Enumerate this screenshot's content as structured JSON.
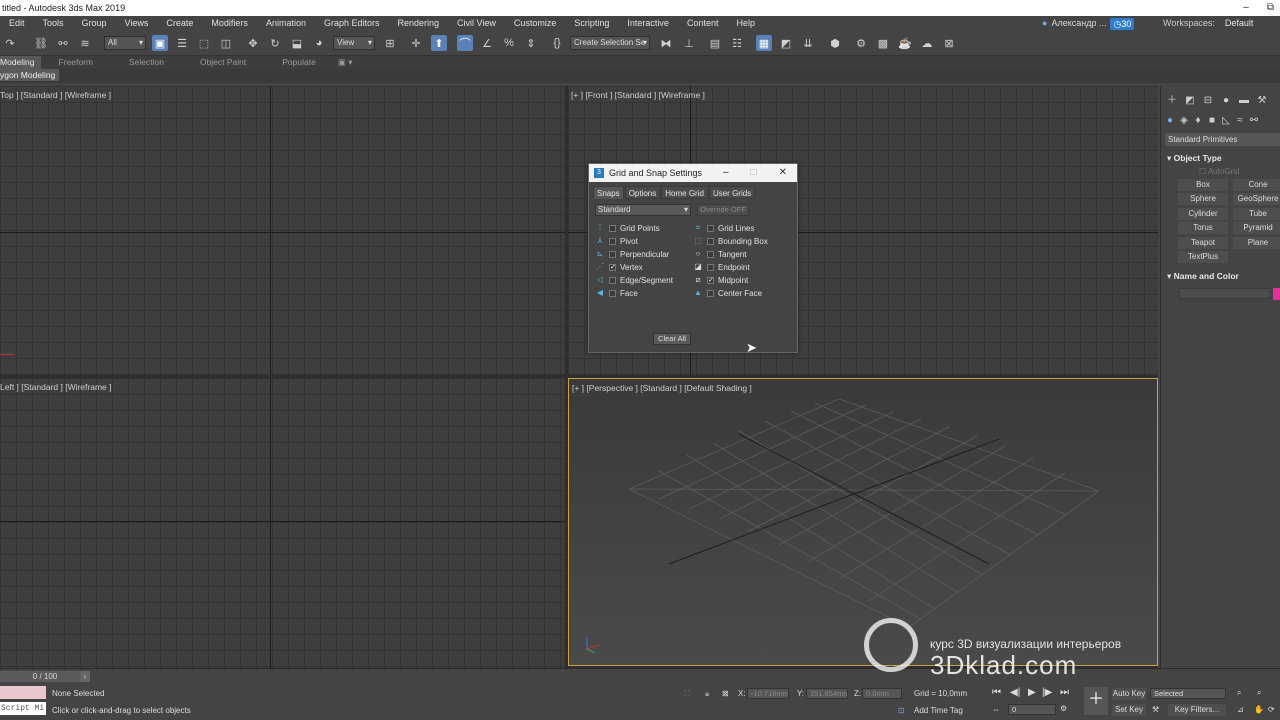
{
  "window": {
    "title": "titled - Autodesk 3ds Max 2019",
    "minimize": "–",
    "restore": "⧉"
  },
  "menu": {
    "items": [
      "Edit",
      "Tools",
      "Group",
      "Views",
      "Create",
      "Modifiers",
      "Animation",
      "Graph Editors",
      "Rendering",
      "Civil View",
      "Customize",
      "Scripting",
      "Interactive",
      "Content",
      "Help"
    ],
    "user": "Александр ...",
    "badge": "30",
    "workspaces_label": "Workspaces:",
    "workspaces_value": "Default"
  },
  "toolbar": {
    "filter": "All",
    "refcoord": "View",
    "named_selection": "Create Selection Se"
  },
  "ribbon": {
    "tabs": [
      "Modeling",
      "Freeform",
      "Selection",
      "Object Paint",
      "Populate"
    ],
    "sub_label": "Polygon Modeling",
    "sub_label_visible": "ygon Modeling"
  },
  "viewports": {
    "top": "Top ] [Standard ] [Wireframe ]",
    "front": "[+ ] [Front ] [Standard ] [Wireframe ]",
    "left": "Left ] [Standard ] [Wireframe ]",
    "perspective": "[+ ] [Perspective ] [Standard ] [Default Shading ]"
  },
  "dialog": {
    "title": "Grid and Snap Settings",
    "tabs": [
      "Snaps",
      "Options",
      "Home Grid",
      "User Grids"
    ],
    "preset": "Standard",
    "override": "Override OFF",
    "snaps_left": [
      {
        "label": "Grid Points",
        "checked": "",
        "icon": "grid-points-icon"
      },
      {
        "label": "Pivot",
        "checked": "",
        "icon": "pivot-icon"
      },
      {
        "label": "Perpendicular",
        "checked": "",
        "icon": "perpendicular-icon"
      },
      {
        "label": "Vertex",
        "checked": "✓",
        "icon": "vertex-icon"
      },
      {
        "label": "Edge/Segment",
        "checked": "",
        "icon": "edge-icon"
      },
      {
        "label": "Face",
        "checked": "",
        "icon": "face-icon"
      }
    ],
    "snaps_right": [
      {
        "label": "Grid Lines",
        "checked": "",
        "icon": "grid-lines-icon"
      },
      {
        "label": "Bounding Box",
        "checked": "",
        "icon": "bounding-box-icon"
      },
      {
        "label": "Tangent",
        "checked": "",
        "icon": "tangent-icon"
      },
      {
        "label": "Endpoint",
        "checked": "",
        "icon": "endpoint-icon"
      },
      {
        "label": "Midpoint",
        "checked": "✓",
        "icon": "midpoint-icon"
      },
      {
        "label": "Center Face",
        "checked": "",
        "icon": "center-face-icon"
      }
    ],
    "clear_all": "Clear All"
  },
  "command_panel": {
    "dropdown": "Standard Primitives",
    "object_type_header": "Object Type",
    "autogrid": "AutoGrid",
    "buttons": [
      "Box",
      "Cone",
      "Sphere",
      "GeoSphere",
      "Cylinder",
      "Tube",
      "Torus",
      "Pyramid",
      "Teapot",
      "Plane",
      "TextPlus"
    ],
    "name_color_header": "Name and Color",
    "color": "#e0309a"
  },
  "status": {
    "frame": "0 / 100",
    "script_label": "Script Mi",
    "selection": "None Selected",
    "prompt": "Click or click-and-drag to select objects",
    "x_label": "X:",
    "x_value": "-10,716mm",
    "y_label": "Y:",
    "y_value": "151,654mm",
    "z_label": "Z:",
    "z_value": "0,0mm",
    "grid": "Grid = 10,0mm",
    "add_time_tag": "Add Time Tag",
    "auto_key": "Auto Key",
    "set_key": "Set Key",
    "selected": "Selected",
    "key_filters": "Key Filters...",
    "frame_field": "0"
  },
  "watermark": {
    "small": "курс 3D визуализации интерьеров",
    "big": "3Dklad.com"
  }
}
